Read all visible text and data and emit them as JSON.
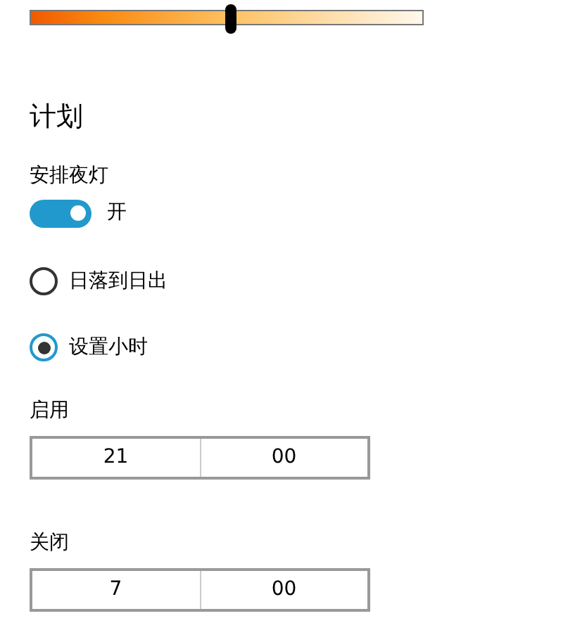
{
  "strength_slider": {
    "level": 0.51
  },
  "schedule": {
    "heading": "计划",
    "toggle_label": "安排夜灯",
    "toggle": {
      "on": true,
      "label": "开"
    },
    "options": [
      {
        "label": "日落到日出",
        "selected": false
      },
      {
        "label": "设置小时",
        "selected": true
      }
    ],
    "times": [
      {
        "label": "启用",
        "hour": "21",
        "minute": "00"
      },
      {
        "label": "关闭",
        "hour": "7",
        "minute": "00"
      }
    ]
  }
}
